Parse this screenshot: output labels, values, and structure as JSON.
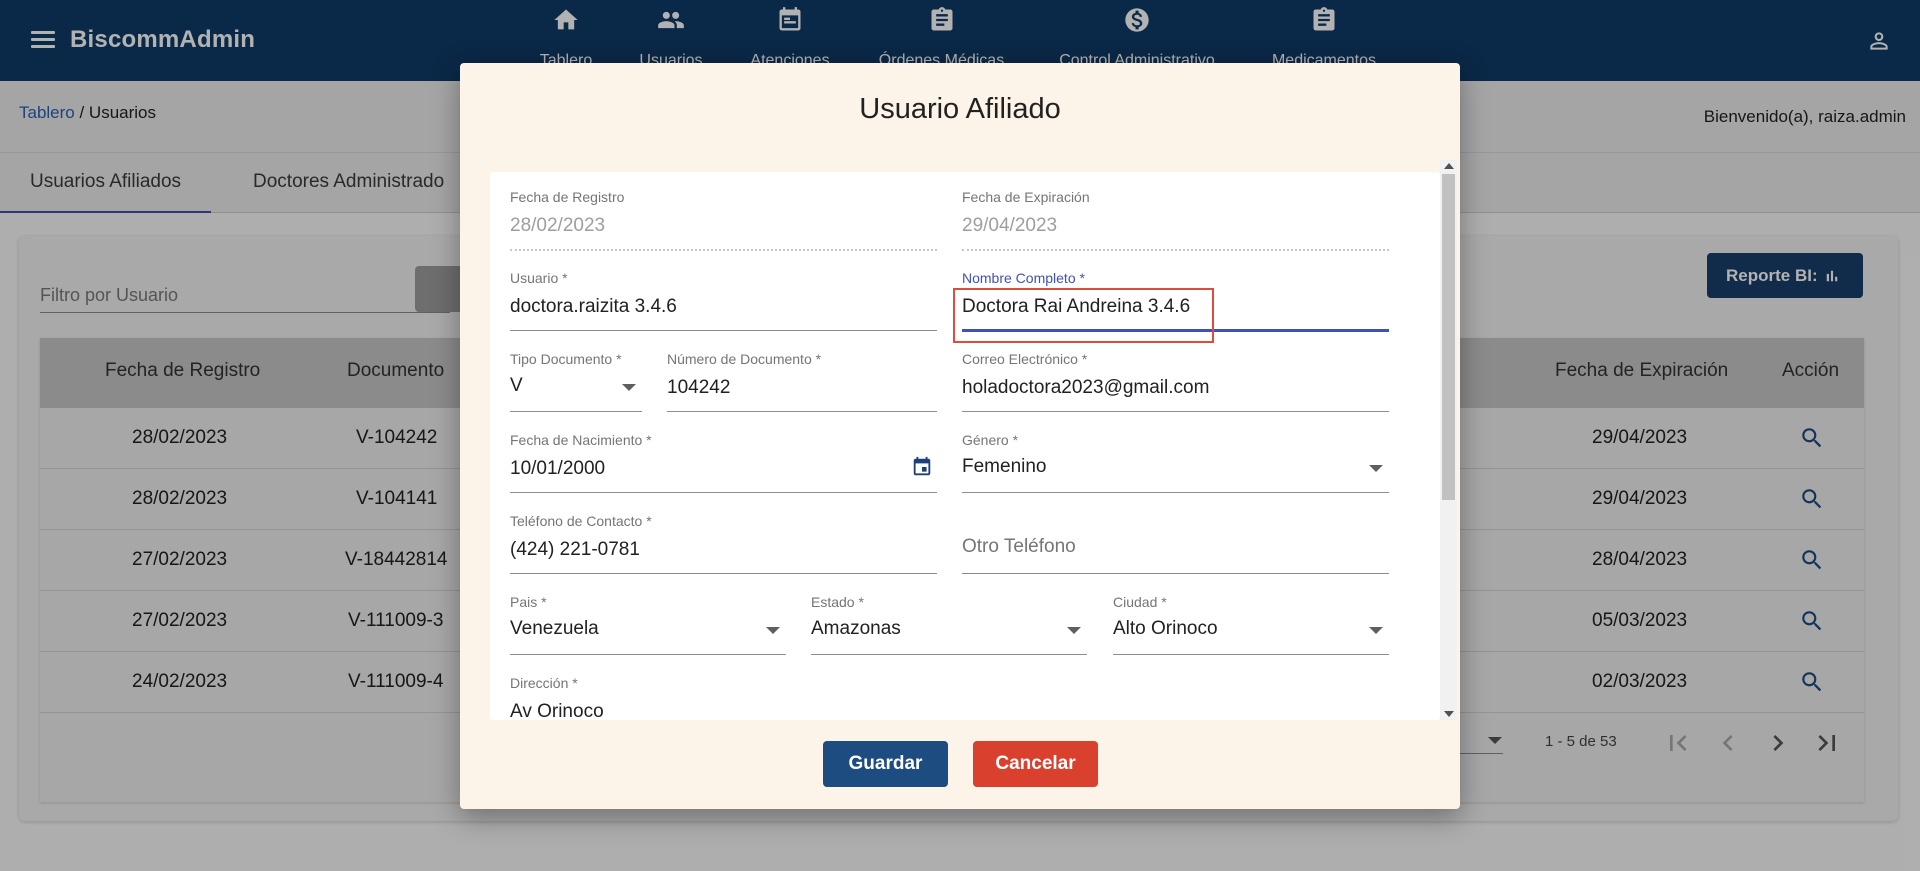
{
  "app": {
    "brand": "BiscommAdmin",
    "nav": [
      {
        "label": "Tablero",
        "icon": "home-icon"
      },
      {
        "label": "Usuarios",
        "icon": "people-icon"
      },
      {
        "label": "Atenciones",
        "icon": "event-icon"
      },
      {
        "label": "Órdenes Médicas",
        "icon": "clipboard-icon"
      },
      {
        "label": "Control Administrativo",
        "icon": "dollar-icon"
      },
      {
        "label": "Medicamentos",
        "icon": "clipboard-icon"
      }
    ]
  },
  "breadcrumb": {
    "link": "Tablero",
    "current": " / Usuarios"
  },
  "welcome": "Bienvenido(a), raiza.admin",
  "tabs": [
    "Usuarios Afiliados",
    "Doctores Administrado"
  ],
  "filter": {
    "placeholder": "Filtro por Usuario"
  },
  "report_button": "Reporte BI:",
  "table": {
    "columns": [
      "Fecha de Registro",
      "Documento",
      "Fecha de Expiración",
      "Acción"
    ],
    "rows": [
      {
        "registro": "28/02/2023",
        "documento": "V-104242",
        "expiracion": "29/04/2023"
      },
      {
        "registro": "28/02/2023",
        "documento": "V-104141",
        "expiracion": "29/04/2023"
      },
      {
        "registro": "27/02/2023",
        "documento": "V-18442814",
        "expiracion": "28/04/2023"
      },
      {
        "registro": "27/02/2023",
        "documento": "V-111009-3",
        "expiracion": "05/03/2023"
      },
      {
        "registro": "24/02/2023",
        "documento": "V-111009-4",
        "expiracion": "02/03/2023"
      }
    ],
    "range": "1 - 5 de 53"
  },
  "dialog": {
    "title": "Usuario Afiliado",
    "fields": {
      "fecha_registro": {
        "label": "Fecha de Registro",
        "value": "28/02/2023"
      },
      "fecha_expiracion": {
        "label": "Fecha de Expiración",
        "value": "29/04/2023"
      },
      "usuario": {
        "label": "Usuario *",
        "value": "doctora.raizita 3.4.6"
      },
      "nombre": {
        "label": "Nombre Completo *",
        "value": "Doctora Rai Andreina 3.4.6"
      },
      "tipo_doc": {
        "label": "Tipo Documento *",
        "value": "V"
      },
      "num_doc": {
        "label": "Número de Documento *",
        "value": "104242"
      },
      "correo": {
        "label": "Correo Electrónico *",
        "value": "holadoctora2023@gmail.com"
      },
      "nacimiento": {
        "label": "Fecha de Nacimiento *",
        "value": "10/01/2000"
      },
      "genero": {
        "label": "Género *",
        "value": "Femenino"
      },
      "telefono": {
        "label": "Teléfono de Contacto *",
        "value": "(424) 221-0781"
      },
      "otro_telefono": {
        "placeholder": "Otro Teléfono"
      },
      "pais": {
        "label": "Pais *",
        "value": "Venezuela"
      },
      "estado": {
        "label": "Estado *",
        "value": "Amazonas"
      },
      "ciudad": {
        "label": "Ciudad *",
        "value": "Alto Orinoco"
      },
      "direccion": {
        "label": "Dirección *",
        "value": "Av Orinoco"
      }
    },
    "save": "Guardar",
    "cancel": "Cancelar"
  },
  "colors": {
    "toolbar": "#0f3a66",
    "accent": "#3f51b5",
    "save": "#1d4c80",
    "cancel": "#d9412e",
    "highlight": "#e04c3c",
    "dialog_bg": "#fcf4e8"
  }
}
